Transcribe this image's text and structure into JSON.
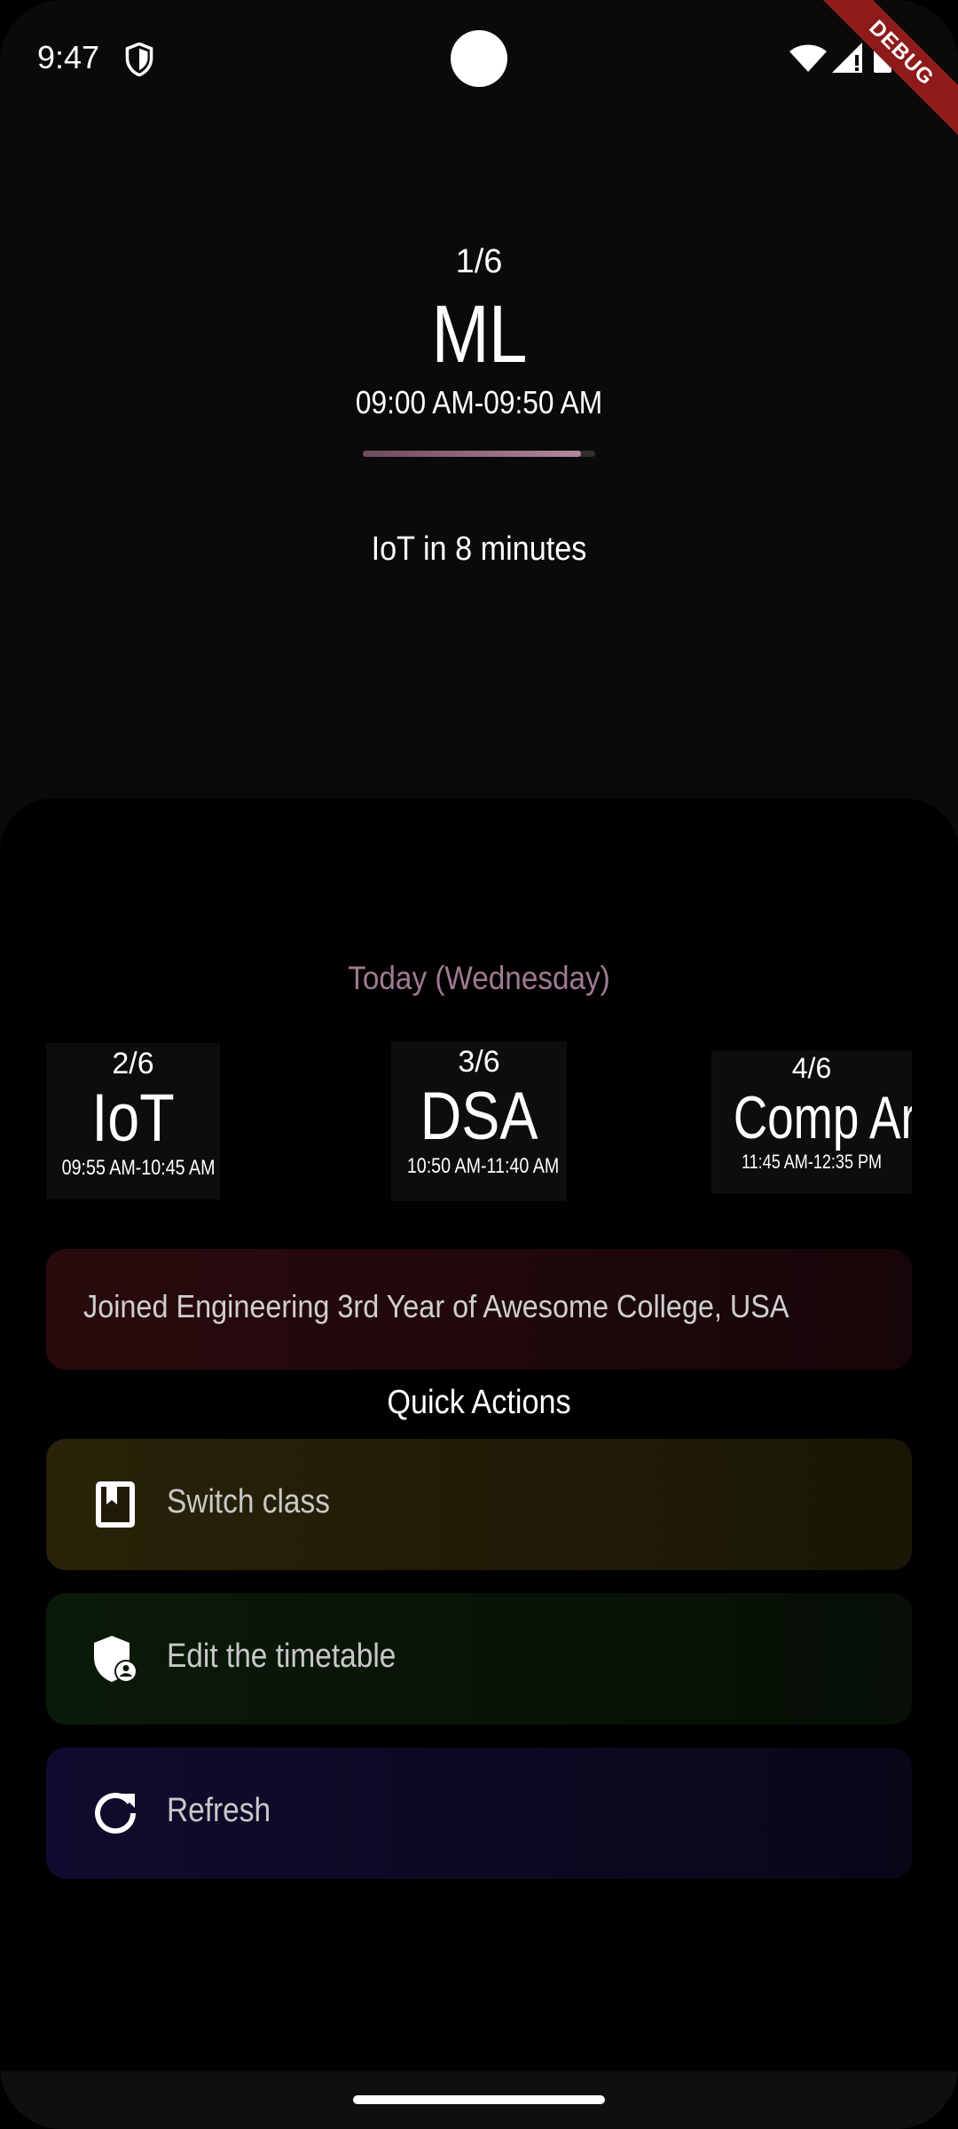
{
  "status_bar": {
    "time": "9:47",
    "icons": [
      "shield-icon",
      "wifi-icon",
      "signal-icon",
      "battery-icon"
    ],
    "debug_label": "DEBUG"
  },
  "current_class": {
    "index": "1/6",
    "name": "ML",
    "time": "09:00 AM-09:50 AM",
    "progress": 0.94,
    "next_up": "IoT in 8 minutes"
  },
  "today": {
    "title": "Today (Wednesday)",
    "periods": [
      {
        "index": "2/6",
        "name": "IoT",
        "time": "09:55 AM-10:45 AM"
      },
      {
        "index": "3/6",
        "name": "DSA",
        "time": "10:50 AM-11:40 AM"
      },
      {
        "index": "4/6",
        "name": "Comp Arc",
        "time": "11:45 AM-12:35 PM"
      }
    ]
  },
  "announcement": "Joined Engineering 3rd Year of Awesome College, USA",
  "quick_actions": {
    "title": "Quick Actions",
    "items": [
      {
        "label": "Switch class",
        "icon": "book-bookmark-icon"
      },
      {
        "label": "Edit the timetable",
        "icon": "admin-shield-icon"
      },
      {
        "label": "Refresh",
        "icon": "refresh-icon"
      }
    ]
  },
  "colors": {
    "accent": "#a07a90",
    "progress": "#b387a0",
    "announcement_bg": "#2a0a0d",
    "switch_bg": "#2a2208",
    "edit_bg": "#0a1a08",
    "refresh_bg": "#120a2e"
  }
}
